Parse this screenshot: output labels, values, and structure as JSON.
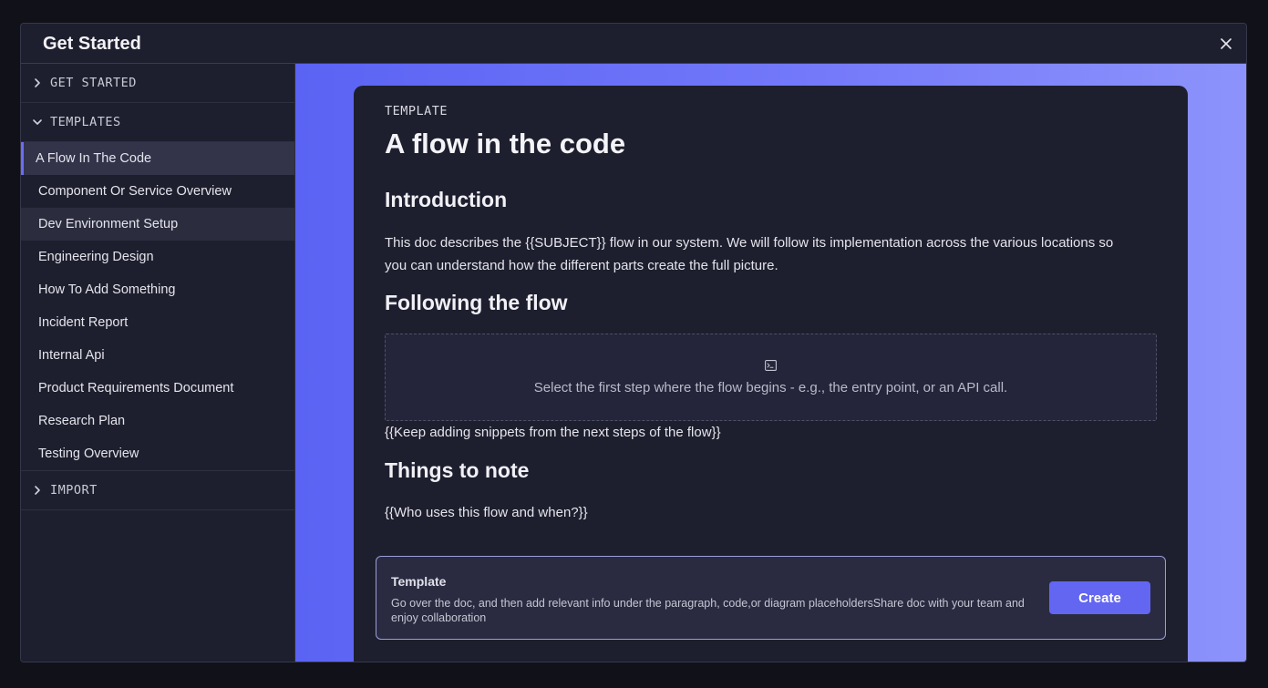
{
  "modal": {
    "title": "Get Started"
  },
  "sidebar": {
    "sections": [
      {
        "label": "GET STARTED",
        "expanded": false
      },
      {
        "label": "TEMPLATES",
        "expanded": true
      },
      {
        "label": "IMPORT",
        "expanded": false
      }
    ],
    "templates": [
      "A Flow In The Code",
      "Component Or Service Overview",
      "Dev Environment Setup",
      "Engineering Design",
      "How To Add Something",
      "Incident Report",
      "Internal Api",
      "Product Requirements Document",
      "Research Plan",
      "Testing Overview"
    ],
    "active_index": 0,
    "hover_index": 2
  },
  "doc": {
    "eyebrow": "TEMPLATE",
    "title": "A flow in the code",
    "intro_heading": "Introduction",
    "intro_text": "This doc describes the {{SUBJECT}} flow in our system. We will follow its implementation across the various locations so you can understand how the different parts create the full picture.",
    "flow_heading": "Following the flow",
    "snippet_placeholder": "Select the first step where the flow begins - e.g., the entry point, or an API call.",
    "flow_followup": "{{Keep adding snippets from the next steps of the flow}}",
    "notes_heading": "Things to note",
    "notes_text": "{{Who uses this flow and when?}}"
  },
  "cta": {
    "title": "Template",
    "description": "Go over the doc, and then add relevant info under the paragraph, code,or diagram placeholdersShare doc with your team and enjoy collaboration",
    "button_label": "Create"
  },
  "colors": {
    "accent": "#6366f1",
    "background": "#1e1f2e",
    "preview_gradient_start": "#5a63f3",
    "preview_gradient_end": "#8d93fb"
  },
  "icons": {
    "close": "close-icon",
    "collapsed": "chevron-right-icon",
    "expanded": "chevron-down-icon",
    "snippet": "terminal-icon"
  }
}
